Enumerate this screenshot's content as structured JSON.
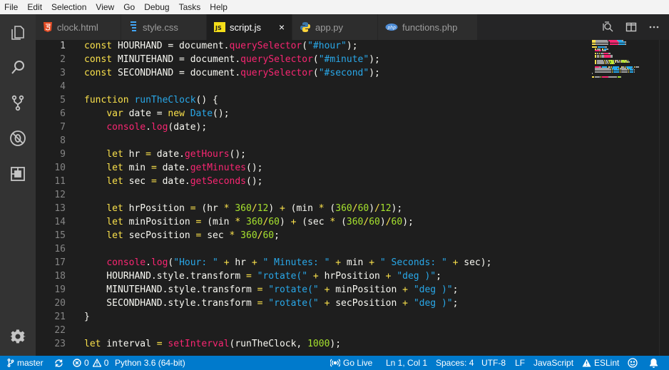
{
  "menu": [
    "File",
    "Edit",
    "Selection",
    "View",
    "Go",
    "Debug",
    "Tasks",
    "Help"
  ],
  "activity": {
    "items": [
      {
        "name": "explorer-icon"
      },
      {
        "name": "search-icon"
      },
      {
        "name": "source-control-icon"
      },
      {
        "name": "debug-icon"
      },
      {
        "name": "extensions-icon"
      }
    ],
    "settings": "gear-icon"
  },
  "tabs": [
    {
      "label": "clock.html",
      "icon": "html5-icon",
      "active": false
    },
    {
      "label": "style.css",
      "icon": "css3-icon",
      "active": false
    },
    {
      "label": "script.js",
      "icon": "javascript-icon",
      "active": true,
      "close": "×"
    },
    {
      "label": "app.py",
      "icon": "python-icon",
      "active": false
    },
    {
      "label": "functions.php",
      "icon": "php-icon",
      "active": false
    }
  ],
  "tab_actions": [
    "open-changes-icon",
    "split-editor-icon",
    "more-actions-icon"
  ],
  "editor": {
    "current_line": 1,
    "lines": [
      {
        "n": "1",
        "tokens": [
          [
            "const",
            "kw"
          ],
          [
            " HOURHAND = document.",
            "def"
          ],
          [
            "querySelector",
            "prop"
          ],
          [
            "(",
            "def"
          ],
          [
            "\"#hour\"",
            "str"
          ],
          [
            ");",
            "def"
          ]
        ]
      },
      {
        "n": "2",
        "tokens": [
          [
            "const",
            "kw"
          ],
          [
            " MINUTEHAND = document.",
            "def"
          ],
          [
            "querySelector",
            "prop"
          ],
          [
            "(",
            "def"
          ],
          [
            "\"#minute\"",
            "str"
          ],
          [
            ");",
            "def"
          ]
        ]
      },
      {
        "n": "3",
        "tokens": [
          [
            "const",
            "kw"
          ],
          [
            " SECONDHAND = document.",
            "def"
          ],
          [
            "querySelector",
            "prop"
          ],
          [
            "(",
            "def"
          ],
          [
            "\"#second\"",
            "str"
          ],
          [
            ");",
            "def"
          ]
        ]
      },
      {
        "n": "4",
        "tokens": []
      },
      {
        "n": "5",
        "tokens": [
          [
            "function",
            "kw"
          ],
          [
            " ",
            "def"
          ],
          [
            "runTheClock",
            "fn"
          ],
          [
            "() {",
            "def"
          ]
        ]
      },
      {
        "n": "6",
        "tokens": [
          [
            "    ",
            "def"
          ],
          [
            "var",
            "kw"
          ],
          [
            " date = ",
            "def"
          ],
          [
            "new",
            "kw"
          ],
          [
            " ",
            "def"
          ],
          [
            "Date",
            "fn"
          ],
          [
            "();",
            "def"
          ]
        ]
      },
      {
        "n": "7",
        "tokens": [
          [
            "    ",
            "def"
          ],
          [
            "console",
            "prop"
          ],
          [
            ".",
            "def"
          ],
          [
            "log",
            "prop"
          ],
          [
            "(date);",
            "def"
          ]
        ]
      },
      {
        "n": "8",
        "tokens": []
      },
      {
        "n": "9",
        "tokens": [
          [
            "    ",
            "def"
          ],
          [
            "let",
            "kw"
          ],
          [
            " hr ",
            "def"
          ],
          [
            "=",
            "op"
          ],
          [
            " date.",
            "def"
          ],
          [
            "getHours",
            "prop"
          ],
          [
            "();",
            "def"
          ]
        ]
      },
      {
        "n": "10",
        "tokens": [
          [
            "    ",
            "def"
          ],
          [
            "let",
            "kw"
          ],
          [
            " min ",
            "def"
          ],
          [
            "=",
            "op"
          ],
          [
            " date.",
            "def"
          ],
          [
            "getMinutes",
            "prop"
          ],
          [
            "();",
            "def"
          ]
        ]
      },
      {
        "n": "11",
        "tokens": [
          [
            "    ",
            "def"
          ],
          [
            "let",
            "kw"
          ],
          [
            " sec ",
            "def"
          ],
          [
            "=",
            "op"
          ],
          [
            " date.",
            "def"
          ],
          [
            "getSeconds",
            "prop"
          ],
          [
            "();",
            "def"
          ]
        ]
      },
      {
        "n": "12",
        "tokens": []
      },
      {
        "n": "13",
        "tokens": [
          [
            "    ",
            "def"
          ],
          [
            "let",
            "kw"
          ],
          [
            " hrPosition ",
            "def"
          ],
          [
            "=",
            "op"
          ],
          [
            " (hr ",
            "def"
          ],
          [
            "*",
            "op"
          ],
          [
            " ",
            "def"
          ],
          [
            "360",
            "num"
          ],
          [
            "/",
            "op"
          ],
          [
            "12",
            "num"
          ],
          [
            ") ",
            "def"
          ],
          [
            "+",
            "op"
          ],
          [
            " (min ",
            "def"
          ],
          [
            "*",
            "op"
          ],
          [
            " (",
            "def"
          ],
          [
            "360",
            "num"
          ],
          [
            "/",
            "op"
          ],
          [
            "60",
            "num"
          ],
          [
            ")",
            "def"
          ],
          [
            "/",
            "op"
          ],
          [
            "12",
            "num"
          ],
          [
            ");",
            "def"
          ]
        ]
      },
      {
        "n": "14",
        "tokens": [
          [
            "    ",
            "def"
          ],
          [
            "let",
            "kw"
          ],
          [
            " minPosition ",
            "def"
          ],
          [
            "=",
            "op"
          ],
          [
            " (min ",
            "def"
          ],
          [
            "*",
            "op"
          ],
          [
            " ",
            "def"
          ],
          [
            "360",
            "num"
          ],
          [
            "/",
            "op"
          ],
          [
            "60",
            "num"
          ],
          [
            ") ",
            "def"
          ],
          [
            "+",
            "op"
          ],
          [
            " (sec ",
            "def"
          ],
          [
            "*",
            "op"
          ],
          [
            " (",
            "def"
          ],
          [
            "360",
            "num"
          ],
          [
            "/",
            "op"
          ],
          [
            "60",
            "num"
          ],
          [
            ")",
            "def"
          ],
          [
            "/",
            "op"
          ],
          [
            "60",
            "num"
          ],
          [
            ");",
            "def"
          ]
        ]
      },
      {
        "n": "15",
        "tokens": [
          [
            "    ",
            "def"
          ],
          [
            "let",
            "kw"
          ],
          [
            " secPosition ",
            "def"
          ],
          [
            "=",
            "op"
          ],
          [
            " sec ",
            "def"
          ],
          [
            "*",
            "op"
          ],
          [
            " ",
            "def"
          ],
          [
            "360",
            "num"
          ],
          [
            "/",
            "op"
          ],
          [
            "60",
            "num"
          ],
          [
            ";",
            "def"
          ]
        ]
      },
      {
        "n": "16",
        "tokens": []
      },
      {
        "n": "17",
        "tokens": [
          [
            "    ",
            "def"
          ],
          [
            "console",
            "prop"
          ],
          [
            ".",
            "def"
          ],
          [
            "log",
            "prop"
          ],
          [
            "(",
            "def"
          ],
          [
            "\"Hour: \"",
            "str"
          ],
          [
            " ",
            "def"
          ],
          [
            "+",
            "op"
          ],
          [
            " hr ",
            "def"
          ],
          [
            "+",
            "op"
          ],
          [
            " ",
            "def"
          ],
          [
            "\" Minutes: \"",
            "str"
          ],
          [
            " ",
            "def"
          ],
          [
            "+",
            "op"
          ],
          [
            " min ",
            "def"
          ],
          [
            "+",
            "op"
          ],
          [
            " ",
            "def"
          ],
          [
            "\" Seconds: \"",
            "str"
          ],
          [
            " ",
            "def"
          ],
          [
            "+",
            "op"
          ],
          [
            " sec);",
            "def"
          ]
        ]
      },
      {
        "n": "18",
        "tokens": [
          [
            "    HOURHAND.style.transform ",
            "def"
          ],
          [
            "=",
            "op"
          ],
          [
            " ",
            "def"
          ],
          [
            "\"rotate(\"",
            "str"
          ],
          [
            " ",
            "def"
          ],
          [
            "+",
            "op"
          ],
          [
            " hrPosition ",
            "def"
          ],
          [
            "+",
            "op"
          ],
          [
            " ",
            "def"
          ],
          [
            "\"deg )\"",
            "str"
          ],
          [
            ";",
            "def"
          ]
        ]
      },
      {
        "n": "19",
        "tokens": [
          [
            "    MINUTEHAND.style.transform ",
            "def"
          ],
          [
            "=",
            "op"
          ],
          [
            " ",
            "def"
          ],
          [
            "\"rotate(\"",
            "str"
          ],
          [
            " ",
            "def"
          ],
          [
            "+",
            "op"
          ],
          [
            " minPosition ",
            "def"
          ],
          [
            "+",
            "op"
          ],
          [
            " ",
            "def"
          ],
          [
            "\"deg )\"",
            "str"
          ],
          [
            ";",
            "def"
          ]
        ]
      },
      {
        "n": "20",
        "tokens": [
          [
            "    SECONDHAND.style.transform ",
            "def"
          ],
          [
            "=",
            "op"
          ],
          [
            " ",
            "def"
          ],
          [
            "\"rotate(\"",
            "str"
          ],
          [
            " ",
            "def"
          ],
          [
            "+",
            "op"
          ],
          [
            " secPosition ",
            "def"
          ],
          [
            "+",
            "op"
          ],
          [
            " ",
            "def"
          ],
          [
            "\"deg )\"",
            "str"
          ],
          [
            ";",
            "def"
          ]
        ]
      },
      {
        "n": "21",
        "tokens": [
          [
            "}",
            "def"
          ]
        ]
      },
      {
        "n": "22",
        "tokens": []
      },
      {
        "n": "23",
        "tokens": [
          [
            "let",
            "kw"
          ],
          [
            " interval ",
            "def"
          ],
          [
            "=",
            "op"
          ],
          [
            " ",
            "def"
          ],
          [
            "setInterval",
            "prop"
          ],
          [
            "(runTheClock, ",
            "def"
          ],
          [
            "1000",
            "num"
          ],
          [
            ");",
            "def"
          ]
        ]
      }
    ]
  },
  "status": {
    "branch": "master",
    "sync_icon": "sync-icon",
    "errors": "0",
    "warnings": "0",
    "python": "Python 3.6 (64-bit)",
    "golive": "Go Live",
    "position": "Ln 1, Col 1",
    "spaces": "Spaces: 4",
    "encoding": "UTF-8",
    "eol": "LF",
    "language": "JavaScript",
    "eslint": "ESLint",
    "feedback_icon": "smiley-icon",
    "notifications_icon": "bell-icon"
  },
  "colors": {
    "keyword": "#f9e04b",
    "property": "#f92672",
    "function": "#29a8e9",
    "string": "#29a8e9",
    "number": "#a6e22e",
    "status_bar": "#007acc"
  }
}
